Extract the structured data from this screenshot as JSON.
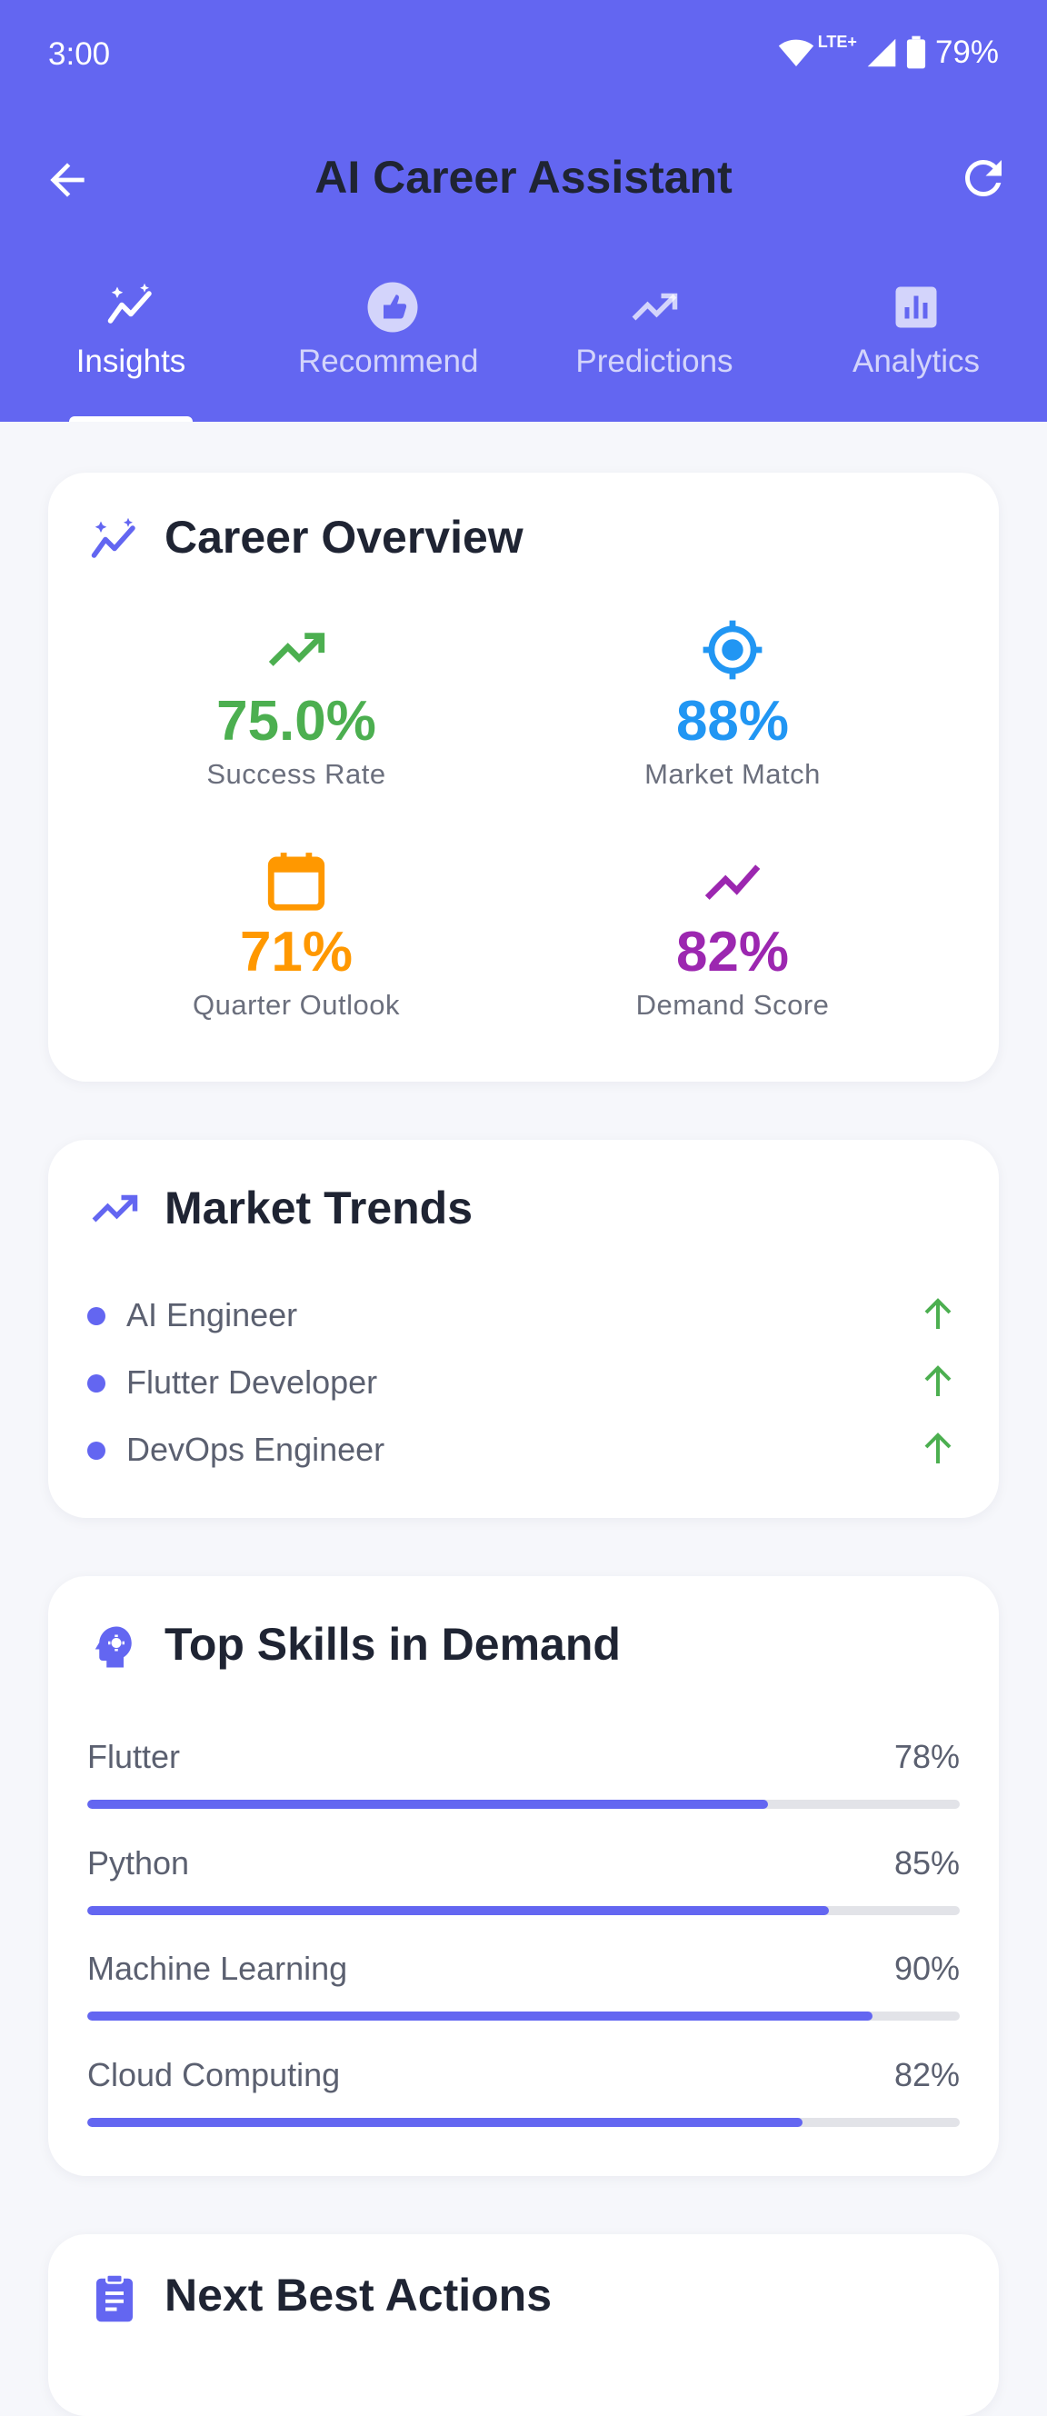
{
  "colors": {
    "primary": "#6366f1",
    "green": "#4caf50",
    "blue": "#2196f3",
    "orange": "#ff9800",
    "purple": "#9c27b0"
  },
  "status_bar": {
    "time": "3:00",
    "network": "LTE+",
    "battery": "79%"
  },
  "app_bar": {
    "title": "AI Career Assistant",
    "back_icon": "arrow-back-icon",
    "refresh_icon": "refresh-icon"
  },
  "tabs": [
    {
      "label": "Insights",
      "icon": "auto-graph-icon",
      "active": true
    },
    {
      "label": "Recommend",
      "icon": "recommend-icon",
      "active": false
    },
    {
      "label": "Predictions",
      "icon": "trending-up-icon",
      "active": false
    },
    {
      "label": "Analytics",
      "icon": "analytics-icon",
      "active": false
    }
  ],
  "career_overview": {
    "title": "Career Overview",
    "stats": [
      {
        "value": "75.0%",
        "label": "Success Rate",
        "icon": "trending-up-icon",
        "color": "#4caf50"
      },
      {
        "value": "88%",
        "label": "Market Match",
        "icon": "target-icon",
        "color": "#2196f3"
      },
      {
        "value": "71%",
        "label": "Quarter Outlook",
        "icon": "calendar-icon",
        "color": "#ff9800"
      },
      {
        "value": "82%",
        "label": "Demand Score",
        "icon": "show-chart-icon",
        "color": "#9c27b0"
      }
    ]
  },
  "market_trends": {
    "title": "Market Trends",
    "items": [
      {
        "name": "AI Engineer",
        "trend": "up"
      },
      {
        "name": "Flutter Developer",
        "trend": "up"
      },
      {
        "name": "DevOps Engineer",
        "trend": "up"
      }
    ]
  },
  "top_skills": {
    "title": "Top Skills in Demand",
    "skills": [
      {
        "name": "Flutter",
        "percent_label": "78%",
        "level": 0.78
      },
      {
        "name": "Python",
        "percent_label": "85%",
        "level": 0.85
      },
      {
        "name": "Machine Learning",
        "percent_label": "90%",
        "level": 0.9
      },
      {
        "name": "Cloud Computing",
        "percent_label": "82%",
        "level": 0.82
      }
    ]
  },
  "next_actions": {
    "title": "Next Best Actions"
  }
}
